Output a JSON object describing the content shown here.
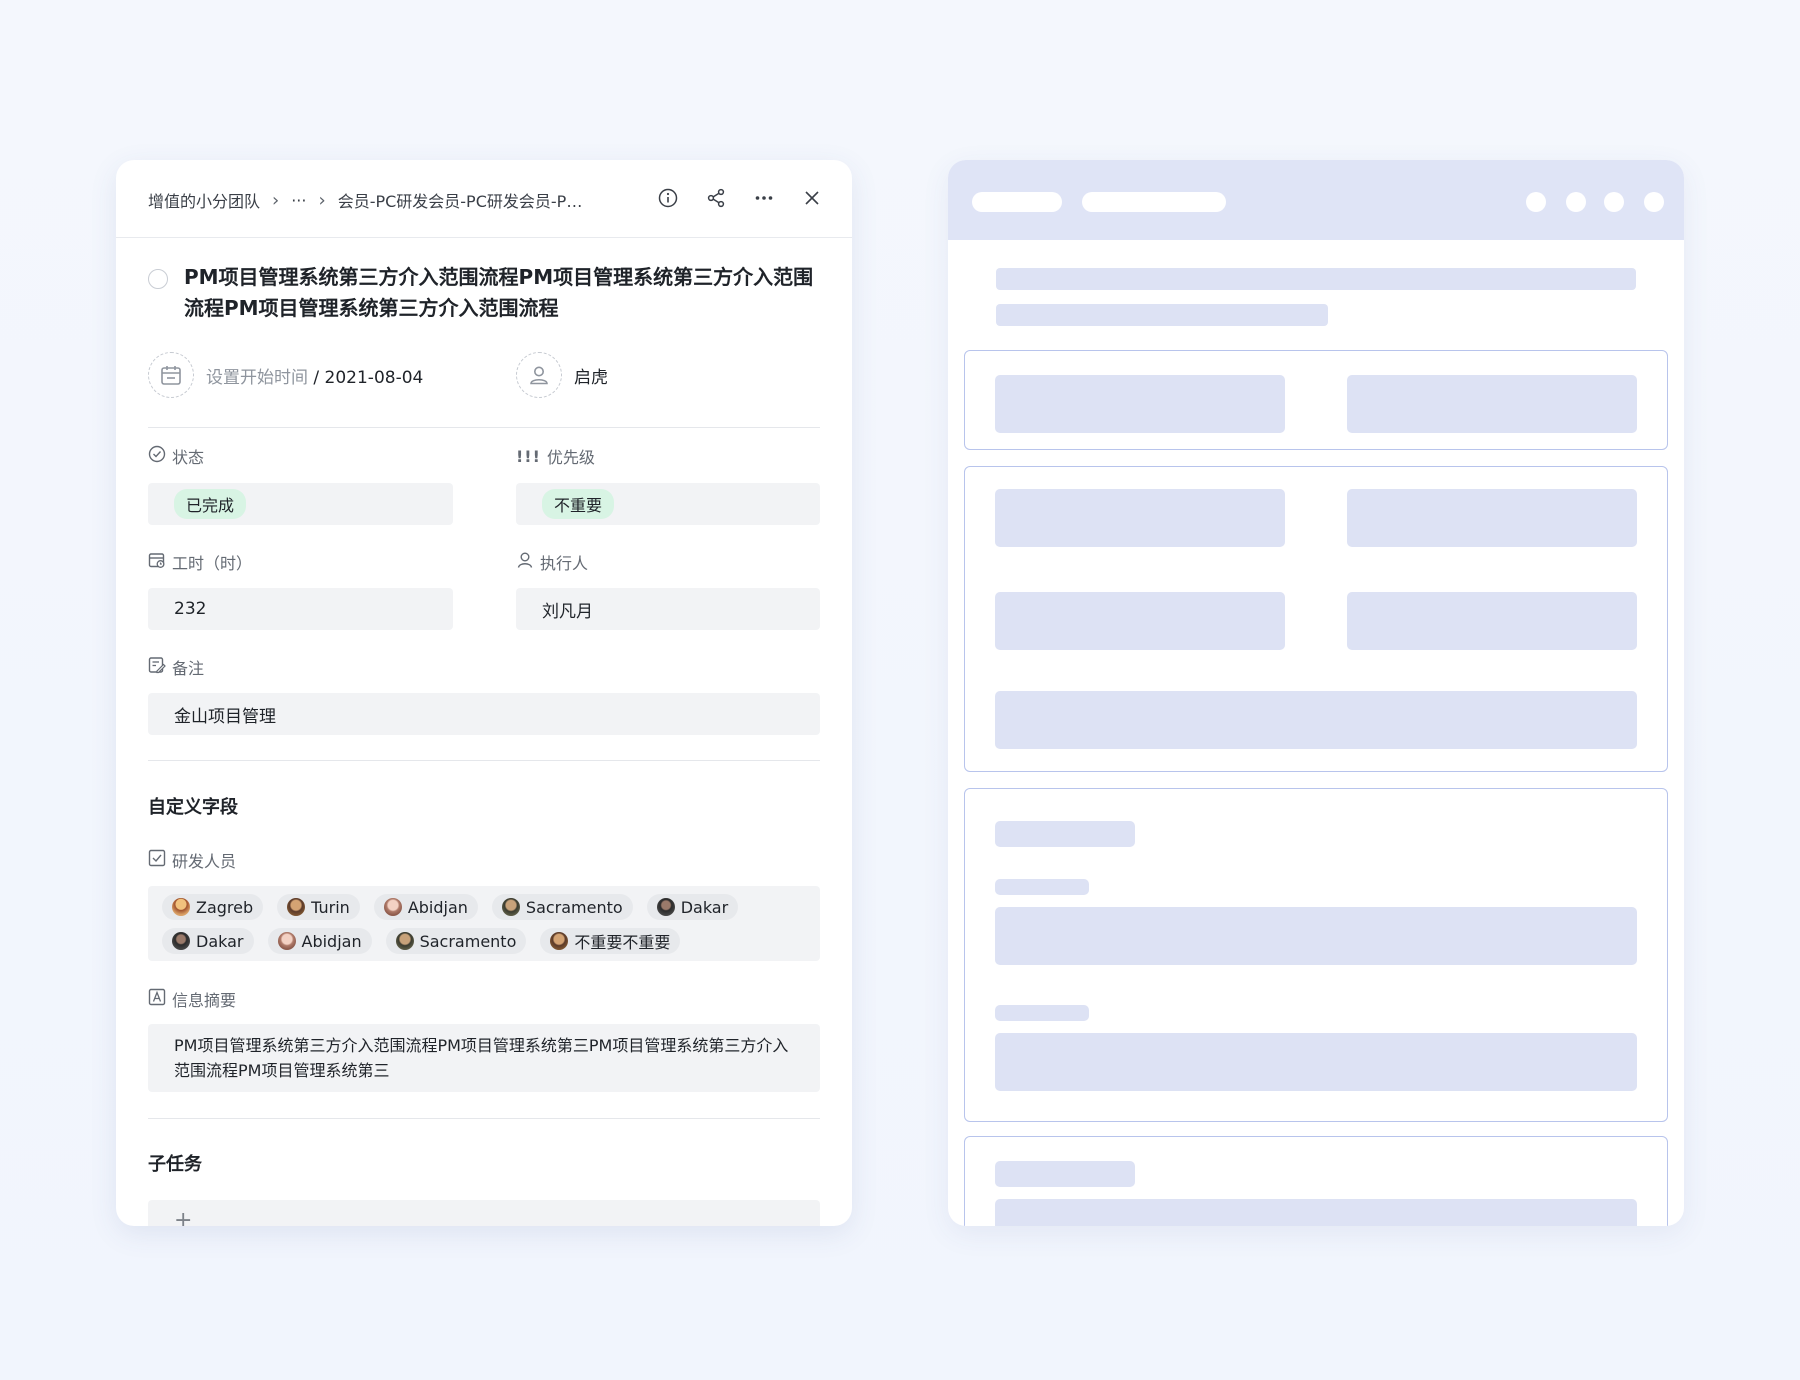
{
  "breadcrumb": {
    "team": "增值的小分团队",
    "ellipsis": "···",
    "current": "会员-PC研发会员-PC研发会员-PC..."
  },
  "actions": {
    "info": "info-icon",
    "share": "share-icon",
    "more": "more-icon",
    "close": "close-icon"
  },
  "task": {
    "title": "PM项目管理系统第三方介入范围流程PM项目管理系统第三方介入范围流程PM项目管理系统第三方介入范围流程",
    "start_placeholder": "设置开始时间",
    "date_separator": " / ",
    "due_date": "2021-08-04",
    "assignee": "启虎"
  },
  "fields": {
    "status": {
      "label": "状态",
      "value": "已完成"
    },
    "priority": {
      "label": "优先级",
      "value": "不重要",
      "icon_text": "!!!"
    },
    "hours": {
      "label": "工时（时）",
      "value": "232"
    },
    "executor": {
      "label": "执行人",
      "value": "刘凡月"
    },
    "note": {
      "label": "备注",
      "value": "金山项目管理"
    }
  },
  "custom_fields": {
    "title": "自定义字段",
    "developers": {
      "label": "研发人员",
      "people": [
        "Zagreb",
        "Turin",
        "Abidjan",
        "Sacramento",
        "Dakar",
        "Dakar",
        "Abidjan",
        "Sacramento",
        "不重要不重要"
      ]
    },
    "summary": {
      "label": "信息摘要",
      "value": "PM项目管理系统第三方介入范围流程PM项目管理系统第三PM项目管理系统第三方介入范围流程PM项目管理系统第三"
    }
  },
  "subtasks": {
    "title": "子任务",
    "add": "+"
  },
  "colors": {
    "background": "#f3f6fd",
    "tag_green": "#d8f4e4",
    "field_bg": "#f2f3f5",
    "skeleton_fill": "#dde2f4",
    "skeleton_border": "#b8c4ec"
  }
}
